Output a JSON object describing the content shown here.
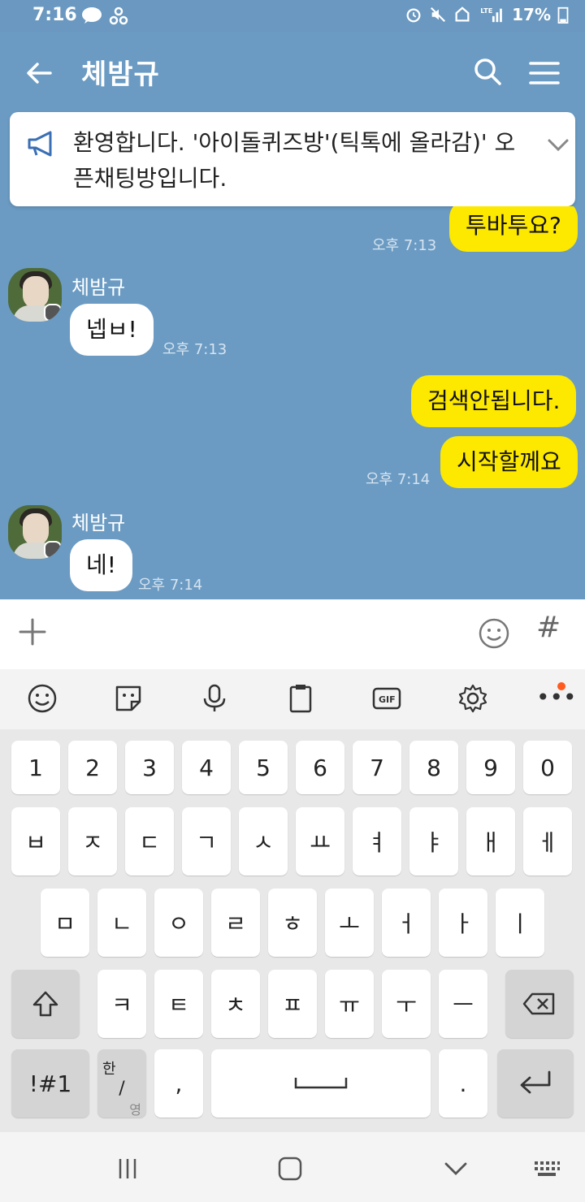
{
  "status": {
    "time": "7:16",
    "battery": "17%"
  },
  "header": {
    "title": "체밤규"
  },
  "notice": {
    "text": "환영합니다. '아이돌퀴즈방'(틱톡에 올라감)' 오픈채팅방입니다."
  },
  "chat": {
    "messages": [
      {
        "from": "me",
        "text": "투바투요?",
        "time": "오후 7:13"
      },
      {
        "from": "them",
        "sender": "체밤규",
        "text": "넵ㅂ!",
        "time": "오후 7:13"
      },
      {
        "from": "me",
        "text": "검색안됩니다.",
        "time": ""
      },
      {
        "from": "me",
        "text": "시작할께요",
        "time": "오후 7:14"
      },
      {
        "from": "them",
        "sender": "체밤규",
        "text": "네!",
        "time": "오후 7:14"
      }
    ]
  },
  "keyboard": {
    "row1": [
      "1",
      "2",
      "3",
      "4",
      "5",
      "6",
      "7",
      "8",
      "9",
      "0"
    ],
    "row2": [
      "ㅂ",
      "ㅈ",
      "ㄷ",
      "ㄱ",
      "ㅅ",
      "ㅛ",
      "ㅕ",
      "ㅑ",
      "ㅐ",
      "ㅔ"
    ],
    "row3": [
      "ㅁ",
      "ㄴ",
      "ㅇ",
      "ㄹ",
      "ㅎ",
      "ㅗ",
      "ㅓ",
      "ㅏ",
      "ㅣ"
    ],
    "row4": [
      "ㅋ",
      "ㅌ",
      "ㅊ",
      "ㅍ",
      "ㅠ",
      "ㅜ",
      "ㅡ"
    ],
    "symbols_label": "!#1",
    "lang_top": "한",
    "lang_bottom": "영",
    "comma": ",",
    "space": "",
    "period": "."
  },
  "inputbar": {
    "hash": "#"
  },
  "icons": [
    "back-arrow-icon",
    "search-icon",
    "hamburger-menu-icon",
    "megaphone-icon",
    "chevron-down-icon",
    "plus-icon",
    "emoji-icon",
    "sticker-icon",
    "microphone-icon",
    "clipboard-icon",
    "gif-icon",
    "gear-icon",
    "more-icon",
    "shift-icon",
    "backspace-icon",
    "enter-icon",
    "recent-apps-icon",
    "home-icon",
    "back-nav-icon",
    "keyboard-icon"
  ]
}
